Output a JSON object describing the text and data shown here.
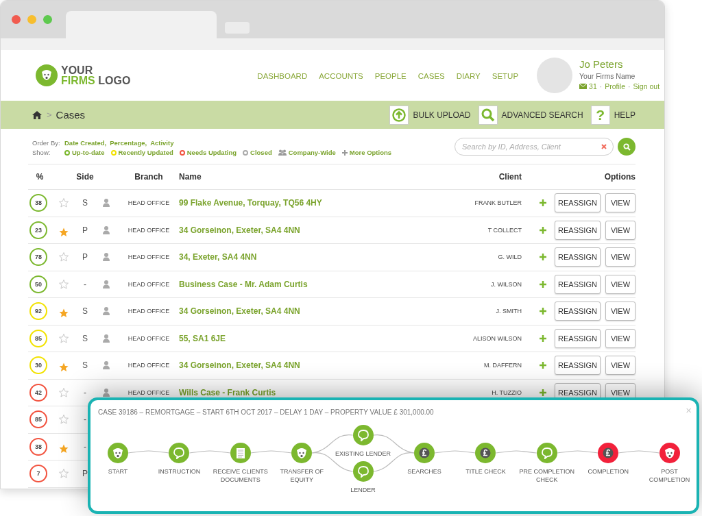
{
  "logo": {
    "line1": "YOUR",
    "accent": "FIRMS",
    "line2": "LOGO"
  },
  "nav": [
    "DASHBOARD",
    "ACCOUNTS",
    "PEOPLE",
    "CASES",
    "DIARY",
    "SETUP"
  ],
  "user": {
    "name": "Jo Peters",
    "firm": "Your Firms Name",
    "links": [
      {
        "kind": "mail",
        "text": "31"
      },
      {
        "kind": "sep",
        "text": "·"
      },
      {
        "kind": "link",
        "text": "Profile"
      },
      {
        "kind": "sep",
        "text": "·"
      },
      {
        "kind": "link",
        "text": "Sign out"
      }
    ]
  },
  "breadcrumb": {
    "separator": ">",
    "title": "Cases"
  },
  "actions": [
    {
      "kind": "upload",
      "label": "BULK UPLOAD"
    },
    {
      "kind": "search",
      "label": "ADVANCED SEARCH"
    },
    {
      "kind": "help",
      "symbol": "?",
      "label": "HELP"
    }
  ],
  "order_by": {
    "label": "Order By:",
    "options": [
      "Date Created,",
      "Percentage,",
      "Activity"
    ]
  },
  "show": {
    "label": "Show:",
    "options": [
      {
        "kind": "dot",
        "color": "#7cb82f",
        "label": "Up-to-date"
      },
      {
        "kind": "dot",
        "color": "#f2e200",
        "label": "Recently Updated"
      },
      {
        "kind": "dot",
        "color": "#f2533f",
        "label": "Needs Updating"
      },
      {
        "kind": "dot",
        "color": "#aaaaaa",
        "label": "Closed"
      },
      {
        "kind": "group",
        "label": "Company-Wide"
      },
      {
        "kind": "plus",
        "label": "More Options"
      }
    ]
  },
  "search": {
    "placeholder": "Search by ID, Address, Client"
  },
  "table": {
    "columns": [
      "%",
      "Side",
      "Branch",
      "Name",
      "Client",
      "Options"
    ],
    "rows": [
      {
        "percent": "38",
        "color": "#7cb82f",
        "starred": false,
        "side": "S",
        "branch": "HEAD OFFICE",
        "name": "99 Flake Avenue, Torquay, TQ56 4HY",
        "client": "FRANK BUTLER",
        "reassign": "REASSIGN",
        "view": "VIEW"
      },
      {
        "percent": "23",
        "color": "#7cb82f",
        "starred": true,
        "side": "P",
        "branch": "HEAD OFFICE",
        "name": "34 Gorseinon, Exeter, SA4 4NN",
        "client": "T COLLECT",
        "reassign": "REASSIGN",
        "view": "VIEW"
      },
      {
        "percent": "78",
        "color": "#7cb82f",
        "starred": false,
        "side": "P",
        "branch": "HEAD OFFICE",
        "name": "34, Exeter, SA4 4NN",
        "client": "G. WILD",
        "reassign": "REASSIGN",
        "view": "VIEW"
      },
      {
        "percent": "50",
        "color": "#7cb82f",
        "starred": false,
        "side": "-",
        "branch": "HEAD OFFICE",
        "name": "Business Case - Mr. Adam Curtis",
        "client": "J. WILSON",
        "reassign": "REASSIGN",
        "view": "VIEW"
      },
      {
        "percent": "92",
        "color": "#f2e200",
        "starred": true,
        "side": "S",
        "branch": "HEAD OFFICE",
        "name": "34 Gorseinon, Exeter, SA4 4NN",
        "client": "J. SMITH",
        "reassign": "REASSIGN",
        "view": "VIEW"
      },
      {
        "percent": "85",
        "color": "#f2e200",
        "starred": false,
        "side": "S",
        "branch": "HEAD OFFICE",
        "name": "55, SA1 6JE",
        "client": "ALISON WILSON",
        "reassign": "REASSIGN",
        "view": "VIEW"
      },
      {
        "percent": "30",
        "color": "#f2e200",
        "starred": true,
        "side": "S",
        "branch": "HEAD OFFICE",
        "name": "34 Gorseinon, Exeter, SA4 4NN",
        "client": "M. DAFFERN",
        "reassign": "REASSIGN",
        "view": "VIEW"
      },
      {
        "percent": "42",
        "color": "#f2533f",
        "starred": false,
        "side": "-",
        "branch": "HEAD OFFICE",
        "name": "Wills Case - Frank Curtis",
        "client": "H. TUZZIO",
        "reassign": "REASSIGN",
        "view": "VIEW"
      },
      {
        "percent": "85",
        "color": "#f2533f",
        "starred": false,
        "side": "-"
      },
      {
        "percent": "38",
        "color": "#f2533f",
        "starred": true,
        "side": "-"
      },
      {
        "percent": "7",
        "color": "#f2533f",
        "starred": false,
        "side": "P"
      }
    ]
  },
  "popup": {
    "title": "CASE 39186 – REMORTGAGE – START 6TH OCT 2017 – DELAY 1 DAY – PROPERTY VALUE £ 301,000.00",
    "close": "×",
    "stages": [
      [
        {
          "kind": "dog",
          "color": "#7cb82f",
          "label": [
            "START"
          ]
        }
      ],
      [
        {
          "kind": "speech",
          "color": "#7cb82f",
          "label": [
            "INSTRUCTION"
          ]
        }
      ],
      [
        {
          "kind": "document",
          "color": "#7cb82f",
          "label": [
            "RECEIVE CLIENTS",
            "DOCUMENTS"
          ]
        }
      ],
      [
        {
          "kind": "dog",
          "color": "#7cb82f",
          "label": [
            "TRANSFER OF",
            "EQUITY"
          ]
        }
      ],
      [
        {
          "kind": "speech",
          "color": "#7cb82f",
          "label": [
            "EXISTING LENDER"
          ]
        },
        {
          "kind": "speech",
          "color": "#7cb82f",
          "label": [
            "LENDER"
          ]
        }
      ],
      [
        {
          "kind": "coin",
          "color": "#7cb82f",
          "label": [
            "SEARCHES"
          ]
        }
      ],
      [
        {
          "kind": "coin",
          "color": "#7cb82f",
          "label": [
            "TITLE CHECK"
          ]
        }
      ],
      [
        {
          "kind": "speech",
          "color": "#7cb82f",
          "label": [
            "PRE COMPLETION",
            "CHECK"
          ]
        }
      ],
      [
        {
          "kind": "coin",
          "color": "#f2213b",
          "label": [
            "COMPLETION"
          ]
        }
      ],
      [
        {
          "kind": "dog",
          "color": "#f2213b",
          "label": [
            "POST",
            "COMPLETION"
          ]
        }
      ]
    ]
  }
}
